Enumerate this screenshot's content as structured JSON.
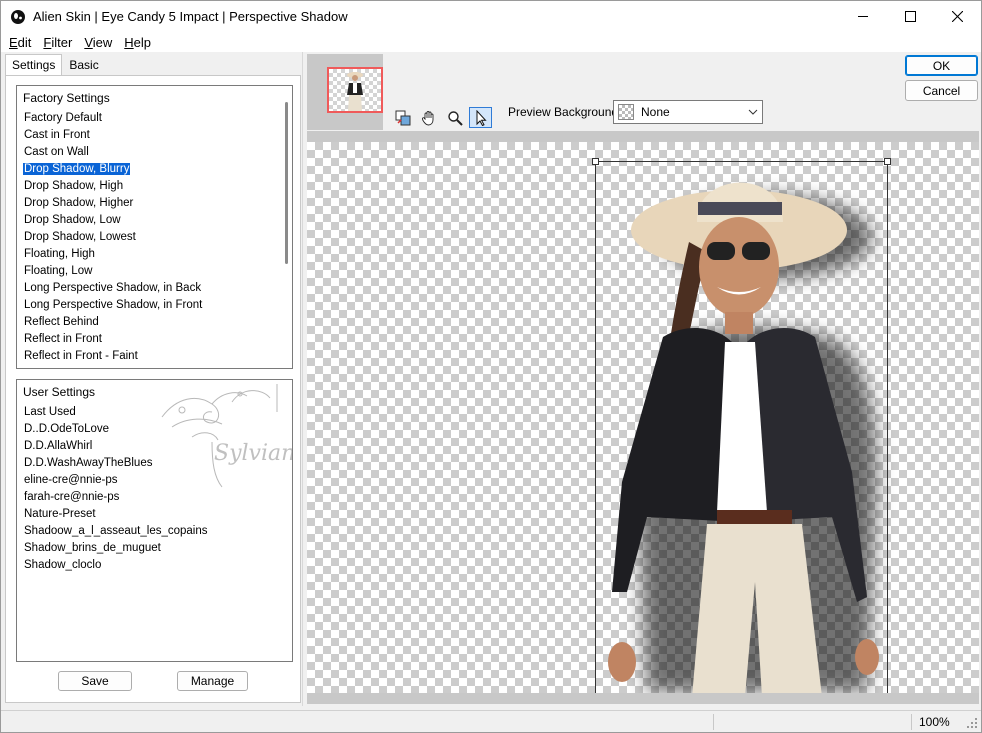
{
  "window": {
    "title": "Alien Skin | Eye Candy 5 Impact | Perspective Shadow"
  },
  "menu": [
    {
      "label": "Edit",
      "key": "E",
      "rest": "dit"
    },
    {
      "label": "Filter",
      "key": "F",
      "rest": "ilter"
    },
    {
      "label": "View",
      "key": "V",
      "rest": "iew"
    },
    {
      "label": "Help",
      "key": "H",
      "rest": "elp"
    }
  ],
  "tabs": {
    "settings": "Settings",
    "basic": "Basic"
  },
  "factory": {
    "header": "Factory Settings",
    "items": [
      "Factory Default",
      "Cast in Front",
      "Cast on Wall",
      "Drop Shadow, Blurry",
      "Drop Shadow, High",
      "Drop Shadow, Higher",
      "Drop Shadow, Low",
      "Drop Shadow, Lowest",
      "Floating, High",
      "Floating, Low",
      "Long Perspective Shadow, in Back",
      "Long Perspective Shadow, in Front",
      "Reflect Behind",
      "Reflect in Front",
      "Reflect in Front - Faint"
    ],
    "selected": "Drop Shadow, Blurry"
  },
  "user": {
    "header": "User Settings",
    "items": [
      "Last Used",
      "D..D.OdeToLove",
      "D.D.AllaWhirl",
      "D.D.WashAwayTheBlues",
      "eline-cre@nnie-ps",
      "farah-cre@nnie-ps",
      "Nature-Preset",
      "Shadoow_a_l_asseaut_les_copains",
      "Shadow_brins_de_muguet",
      "Shadow_cloclo"
    ],
    "watermark": "Sylviane"
  },
  "buttons": {
    "save": "Save",
    "manage": "Manage",
    "ok": "OK",
    "cancel": "Cancel"
  },
  "preview": {
    "background_label": "Preview Background:",
    "background_value": "None"
  },
  "tools": [
    "compare-icon",
    "hand-pan-icon",
    "zoom-icon",
    "arrow-select-icon"
  ],
  "status": {
    "zoom": "100%"
  },
  "colors": {
    "selection": "#0a64d6",
    "thumb_border": "#f05a5a",
    "ok_border": "#0078d4"
  }
}
